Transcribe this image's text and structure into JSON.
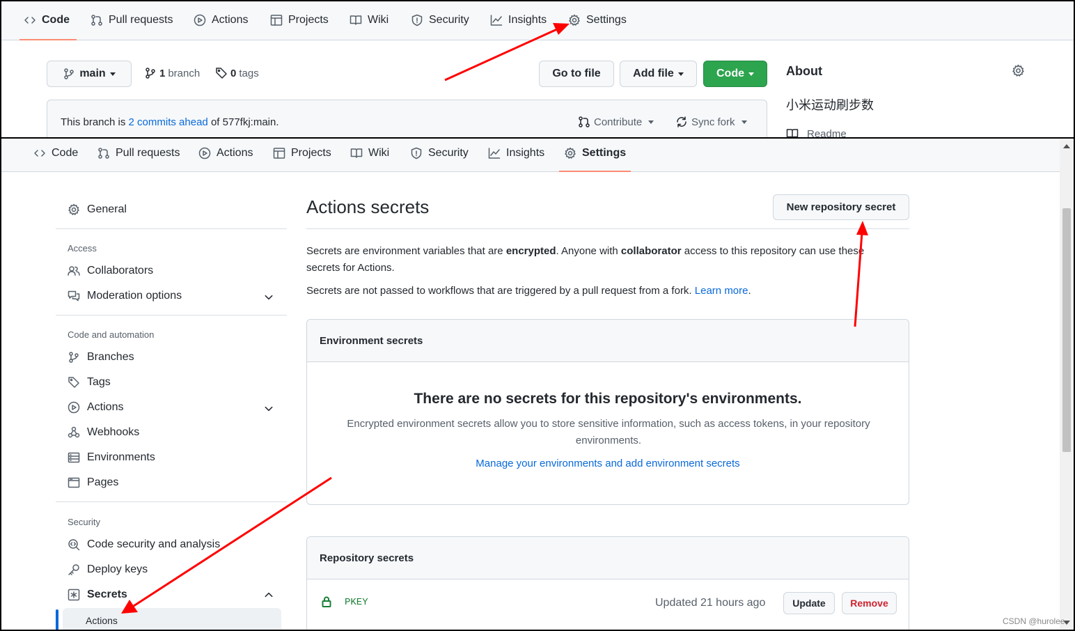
{
  "top": {
    "tabs": [
      {
        "label": "Code",
        "icon": "code-icon"
      },
      {
        "label": "Pull requests",
        "icon": "pull-request-icon"
      },
      {
        "label": "Actions",
        "icon": "play-icon"
      },
      {
        "label": "Projects",
        "icon": "table-icon"
      },
      {
        "label": "Wiki",
        "icon": "book-icon"
      },
      {
        "label": "Security",
        "icon": "shield-icon"
      },
      {
        "label": "Insights",
        "icon": "graph-icon"
      },
      {
        "label": "Settings",
        "icon": "gear-icon"
      }
    ],
    "branch_select": "main",
    "branch_count": "1",
    "branch_word": "branch",
    "tag_count": "0",
    "tag_word": "tags",
    "go_to_file": "Go to file",
    "add_file": "Add file",
    "code_button": "Code",
    "about_title": "About",
    "about_description": "小米运动刷步数",
    "readme_label": "Readme",
    "flash": {
      "prefix": "This branch is",
      "link": "2 commits ahead",
      "suffix": "of 577fkj:main.",
      "contribute": "Contribute",
      "sync_fork": "Sync fork"
    }
  },
  "bottom": {
    "tabs": [
      {
        "label": "Code",
        "icon": "code-icon"
      },
      {
        "label": "Pull requests",
        "icon": "pull-request-icon"
      },
      {
        "label": "Actions",
        "icon": "play-icon"
      },
      {
        "label": "Projects",
        "icon": "table-icon"
      },
      {
        "label": "Wiki",
        "icon": "book-icon"
      },
      {
        "label": "Security",
        "icon": "shield-icon"
      },
      {
        "label": "Insights",
        "icon": "graph-icon"
      },
      {
        "label": "Settings",
        "icon": "gear-icon"
      }
    ],
    "sidebar": {
      "general": "General",
      "access_heading": "Access",
      "collaborators": "Collaborators",
      "moderation": "Moderation options",
      "code_automation_heading": "Code and automation",
      "branches": "Branches",
      "tags": "Tags",
      "actions": "Actions",
      "webhooks": "Webhooks",
      "environments": "Environments",
      "pages": "Pages",
      "security_heading": "Security",
      "code_security": "Code security and analysis",
      "deploy_keys": "Deploy keys",
      "secrets": "Secrets",
      "secrets_actions": "Actions"
    },
    "main": {
      "title": "Actions secrets",
      "new_secret_button": "New repository secret",
      "desc1_a": "Secrets are environment variables that are ",
      "desc1_b": "encrypted",
      "desc1_c": ". Anyone with ",
      "desc1_d": "collaborator",
      "desc1_e": " access to this repository can use these secrets for Actions.",
      "desc2": "Secrets are not passed to workflows that are triggered by a pull request from a fork.",
      "learn_more": "Learn more",
      "env_box_title": "Environment secrets",
      "env_empty_title": "There are no secrets for this repository's environments.",
      "env_empty_desc": "Encrypted environment secrets allow you to store sensitive information, such as access tokens, in your repository environments.",
      "env_manage_link": "Manage your environments and add environment secrets",
      "repo_box_title": "Repository secrets",
      "secret_name": "PKEY",
      "secret_updated": "Updated 21 hours ago",
      "update_button": "Update",
      "remove_button": "Remove"
    },
    "watermark": "CSDN @hurolee"
  },
  "colors": {
    "accent_underline": "#fd8c73",
    "link": "#0969da",
    "green": "#2da44e",
    "danger": "#cf222e",
    "annotation_arrow": "#ff0000"
  }
}
